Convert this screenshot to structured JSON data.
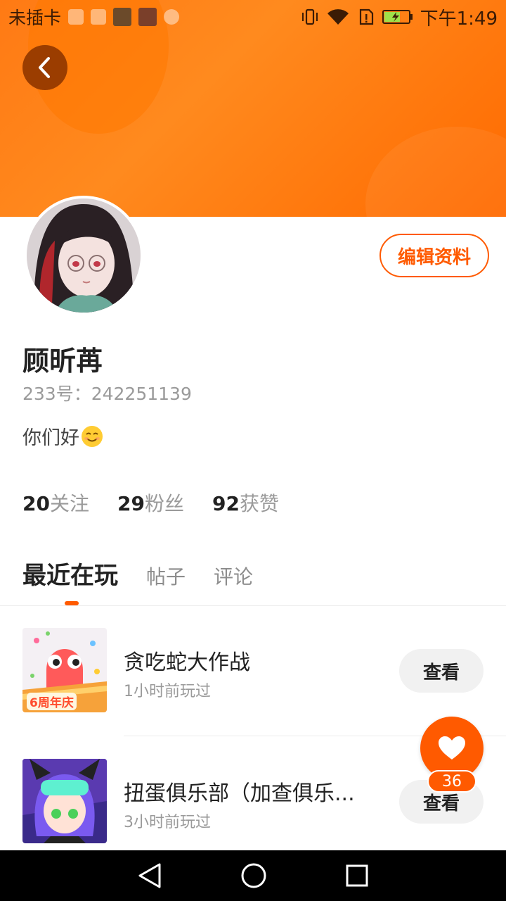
{
  "status_bar": {
    "carrier": "未插卡",
    "time": "下午1:49"
  },
  "profile": {
    "name": "顾昕苒",
    "id_text": "233号：242251139",
    "bio": "你们好",
    "edit_label": "编辑资料"
  },
  "stats": [
    {
      "num": "20",
      "label": "关注"
    },
    {
      "num": "29",
      "label": "粉丝"
    },
    {
      "num": "92",
      "label": "获赞"
    }
  ],
  "tabs": [
    {
      "label": "最近在玩",
      "active": true
    },
    {
      "label": "帖子",
      "active": false
    },
    {
      "label": "评论",
      "active": false
    }
  ],
  "games": [
    {
      "title": "贪吃蛇大作战",
      "time": "1小时前玩过",
      "button": "查看",
      "icon_badge": "6周年庆"
    },
    {
      "title": "扭蛋俱乐部（加查俱乐...",
      "time": "3小时前玩过",
      "button": "查看"
    }
  ],
  "fab": {
    "badge": "36"
  },
  "colors": {
    "accent": "#ff5a00",
    "header": "#ff7a14"
  }
}
